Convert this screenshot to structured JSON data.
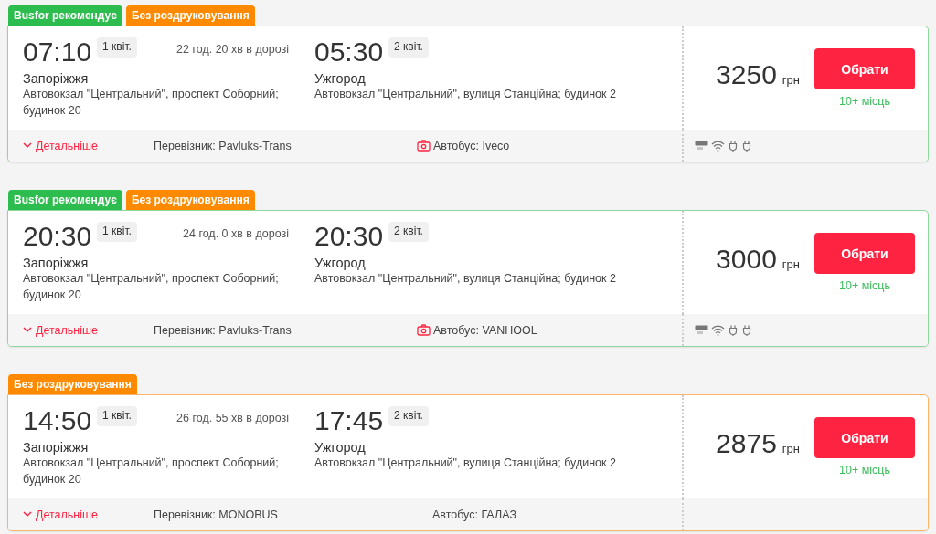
{
  "trips": [
    {
      "recommended": true,
      "tags": [
        {
          "kind": "recommended",
          "label": "Busfor рекомендує"
        },
        {
          "kind": "no-print",
          "label": "Без роздруковування"
        }
      ],
      "departure": {
        "time": "07:10",
        "ticket": "1 квіт.",
        "city": "Запоріжжя",
        "station": "Автовокзал \"Центральний\", проспект Соборний; будинок 20"
      },
      "duration": "22 год. 20 хв в дорозі",
      "arrival": {
        "time": "05:30",
        "ticket": "2 квіт.",
        "city": "Ужгород",
        "station": "Автовокзал \"Центральний\", вулиця Станційна; будинок 2"
      },
      "price": "3250",
      "currency": "грн",
      "button": "Обрати",
      "seats": "10+ місць",
      "details": "Детальніше",
      "carrier": "Перевізник: Pavluks-Trans",
      "bus": "Автобус: Iveco",
      "photo": true,
      "amenities": [
        {
          "kind": "ac"
        },
        {
          "kind": "wifi"
        },
        {
          "kind": "socket"
        },
        {
          "kind": "socket"
        }
      ]
    },
    {
      "recommended": true,
      "tags": [
        {
          "kind": "recommended",
          "label": "Busfor рекомендує"
        },
        {
          "kind": "no-print",
          "label": "Без роздруковування"
        }
      ],
      "departure": {
        "time": "20:30",
        "ticket": "1 квіт.",
        "city": "Запоріжжя",
        "station": "Автовокзал \"Центральний\", проспект Соборний; будинок 20"
      },
      "duration": "24 год. 0 хв в дорозі",
      "arrival": {
        "time": "20:30",
        "ticket": "2 квіт.",
        "city": "Ужгород",
        "station": "Автовокзал \"Центральний\", вулиця Станційна; будинок 2"
      },
      "price": "3000",
      "currency": "грн",
      "button": "Обрати",
      "seats": "10+ місць",
      "details": "Детальніше",
      "carrier": "Перевізник: Pavluks-Trans",
      "bus": "Автобус: VANHOOL",
      "photo": true,
      "amenities": [
        {
          "kind": "ac"
        },
        {
          "kind": "wifi"
        },
        {
          "kind": "socket"
        },
        {
          "kind": "socket"
        }
      ]
    },
    {
      "recommended": false,
      "tags": [
        {
          "kind": "no-print",
          "label": "Без роздруковування"
        }
      ],
      "departure": {
        "time": "14:50",
        "ticket": "1 квіт.",
        "city": "Запоріжжя",
        "station": "Автовокзал \"Центральний\", проспект Соборний; будинок 20"
      },
      "duration": "26 год. 55 хв в дорозі",
      "arrival": {
        "time": "17:45",
        "ticket": "2 квіт.",
        "city": "Ужгород",
        "station": "Автовокзал \"Центральний\", вулиця Станційна; будинок 2"
      },
      "price": "2875",
      "currency": "грн",
      "button": "Обрати",
      "seats": "10+ місць",
      "details": "Детальніше",
      "carrier": "Перевізник: MONOBUS",
      "bus": "Автобус: ГАЛАЗ",
      "photo": false
    }
  ]
}
